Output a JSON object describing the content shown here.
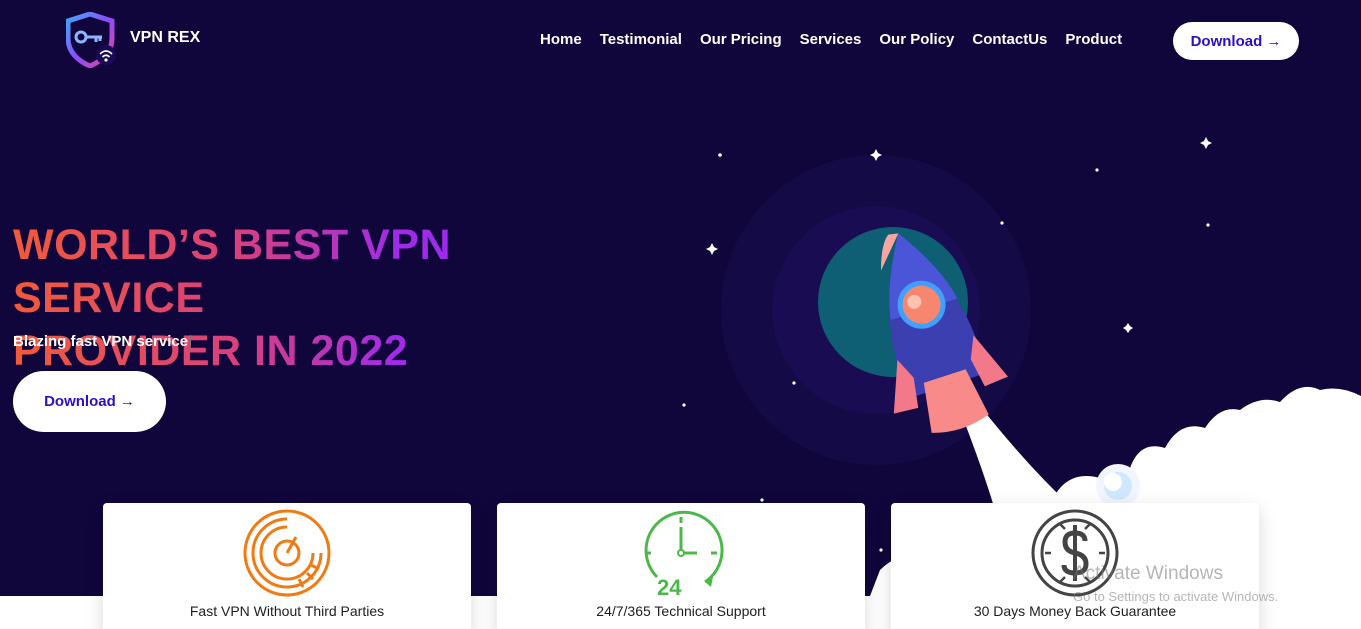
{
  "brand": {
    "name": "VPN REX"
  },
  "nav": {
    "items": [
      "Home",
      "Testimonial",
      "Our Pricing",
      "Services",
      "Our Policy",
      "ContactUs",
      "Product"
    ],
    "download_label": "Download →"
  },
  "hero": {
    "title_line1": "WORLD’S BEST VPN SERVICE",
    "title_line2": "PROVIDER IN 2022",
    "subtitle": "Blazing fast VPN service",
    "download_label": "Download →"
  },
  "features": [
    {
      "label": "Fast VPN Without Third Parties",
      "icon": "speedometer-icon",
      "color": "#f07b14"
    },
    {
      "label": "24/7/365 Technical Support",
      "icon": "clock-24-icon",
      "color": "#4db84a",
      "icon_text": "24"
    },
    {
      "label": "30 Days Money Back Guarantee",
      "icon": "dollar-coin-icon",
      "color": "#444444"
    }
  ],
  "watermark": {
    "title": "Activate Windows",
    "subtitle": "Go to Settings to activate Windows."
  },
  "colors": {
    "background": "#10063b",
    "button_text": "#2b0ec8",
    "gradient": [
      "#f25a3a",
      "#d9407e",
      "#a02be8",
      "#8a2bff"
    ]
  }
}
